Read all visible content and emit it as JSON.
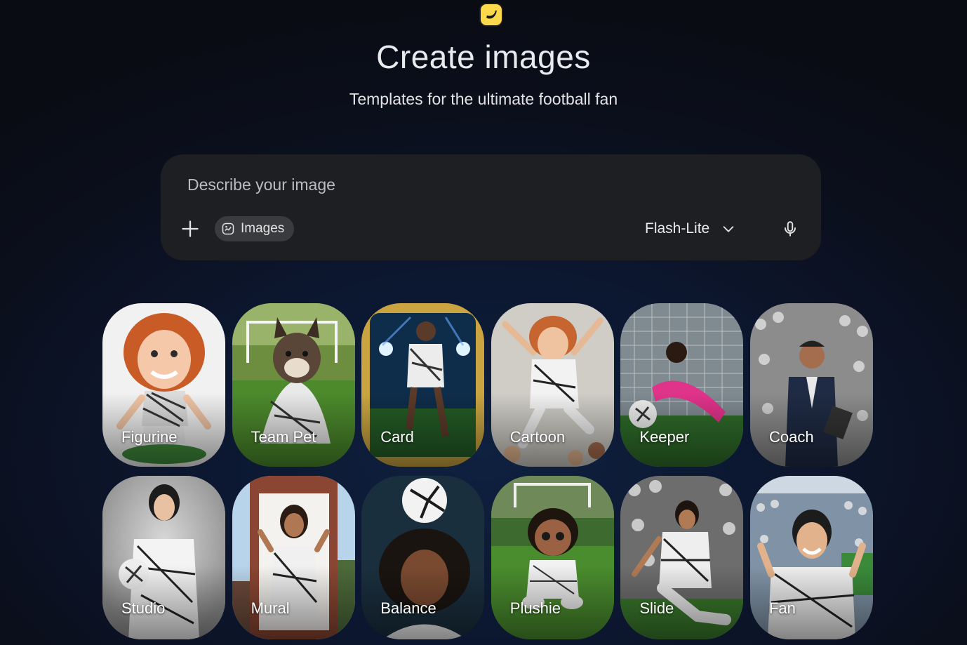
{
  "header": {
    "logo_icon": "banana-icon",
    "title": "Create images",
    "subtitle": "Templates for the ultimate football fan"
  },
  "prompt": {
    "placeholder": "Describe your image",
    "value": "",
    "add_icon": "plus-icon",
    "tool_chip": {
      "icon": "image-icon",
      "label": "Images"
    },
    "model": {
      "label": "Flash-Lite",
      "icon": "chevron-down-icon"
    },
    "mic_icon": "microphone-icon"
  },
  "templates": [
    {
      "label": "Figurine"
    },
    {
      "label": "Team Pet"
    },
    {
      "label": "Card"
    },
    {
      "label": "Cartoon"
    },
    {
      "label": "Keeper"
    },
    {
      "label": "Coach"
    },
    {
      "label": "Studio"
    },
    {
      "label": "Mural"
    },
    {
      "label": "Balance"
    },
    {
      "label": "Plushie"
    },
    {
      "label": "Slide"
    },
    {
      "label": "Fan"
    }
  ],
  "colors": {
    "background": "#0b0f1c",
    "prompt_box": "#1e1f22",
    "chip": "#3a3b3e",
    "logo": "#fbd94a"
  }
}
